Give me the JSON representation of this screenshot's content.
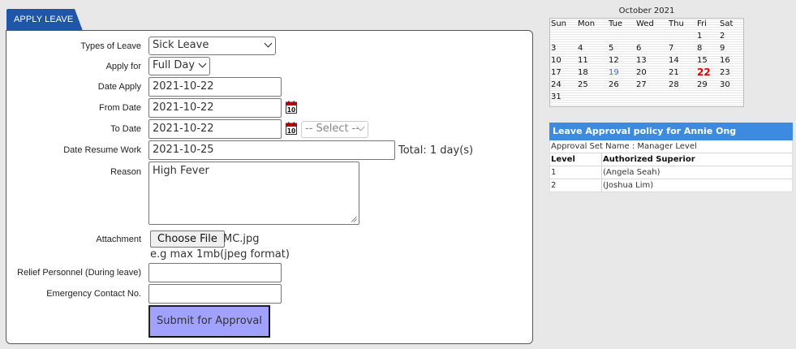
{
  "tab": {
    "label": "APPLY LEAVE"
  },
  "form": {
    "types_of_leave": {
      "label": "Types of Leave",
      "value": "Sick Leave"
    },
    "apply_for": {
      "label": "Apply for",
      "value": "Full Day"
    },
    "date_apply": {
      "label": "Date Apply",
      "value": "2021-10-22"
    },
    "from_date": {
      "label": "From Date",
      "value": "2021-10-22"
    },
    "to_date": {
      "label": "To Date",
      "value": "2021-10-22",
      "period_select": "-- Select --"
    },
    "date_resume": {
      "label": "Date Resume Work",
      "value": "2021-10-25",
      "total": "Total: 1 day(s)"
    },
    "reason": {
      "label": "Reason",
      "value": "High Fever"
    },
    "attachment": {
      "label": "Attachment",
      "button": "Choose File",
      "filename": "MC.jpg",
      "hint": "e.g max 1mb(jpeg format)"
    },
    "relief_personnel": {
      "label": "Relief Personnel (During leave)",
      "value": ""
    },
    "emergency_contact": {
      "label": "Emergency Contact No.",
      "value": ""
    },
    "submit_label": "Submit for Approval",
    "calendar_icon_day": "10"
  },
  "calendar": {
    "title": "October 2021",
    "weekdays": [
      "Sun",
      "Mon",
      "Tue",
      "Wed",
      "Thu",
      "Fri",
      "Sat"
    ],
    "weeks": [
      [
        "",
        "",
        "",
        "",
        "",
        "1",
        "2"
      ],
      [
        "3",
        "4",
        "5",
        "6",
        "7",
        "8",
        "9"
      ],
      [
        "10",
        "11",
        "12",
        "13",
        "14",
        "15",
        "16"
      ],
      [
        "17",
        "18",
        "19",
        "20",
        "21",
        "22",
        "23"
      ],
      [
        "24",
        "25",
        "26",
        "27",
        "28",
        "29",
        "30"
      ],
      [
        "31",
        "",
        "",
        "",
        "",
        "",
        ""
      ]
    ],
    "highlight_blue": "19",
    "today": "22"
  },
  "policy": {
    "title": "Leave Approval policy for Annie Ong",
    "approval_set": "Approval Set Name : Manager Level",
    "col_level": "Level",
    "col_superior": "Authorized Superior",
    "rows": [
      {
        "level": "1",
        "superior": "(Angela Seah)"
      },
      {
        "level": "2",
        "superior": "(Joshua Lim)"
      }
    ]
  },
  "colors": {
    "tab_bg": "#1f56a8",
    "policy_header": "#3c8be0",
    "submit_bg": "#a1a1ff",
    "today": "#e00000",
    "highlight": "#3a6fc4"
  }
}
